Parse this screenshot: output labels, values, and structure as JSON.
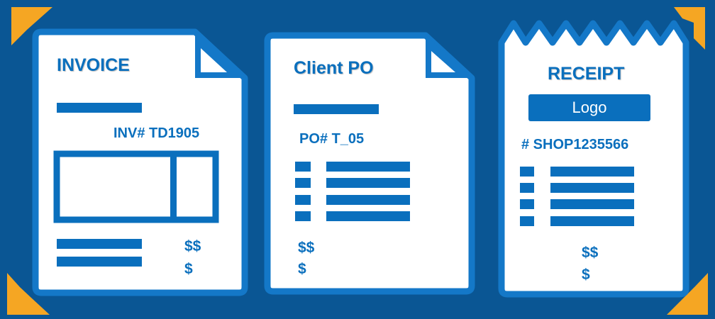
{
  "colors": {
    "background": "#0a5694",
    "accent_corner": "#f5a623",
    "document_fill": "#ffffff",
    "document_border": "#1478c8",
    "document_ink": "#0a6fbd"
  },
  "documents": {
    "invoice": {
      "title": "INVOICE",
      "number": "INV# TD1905",
      "amount_line_1": "$$",
      "amount_line_2": "$"
    },
    "client_po": {
      "title": "Client PO",
      "number": "PO# T_05",
      "amount_line_1": "$$",
      "amount_line_2": "$"
    },
    "receipt": {
      "title": "RECEIPT",
      "logo_label": "Logo",
      "number": "# SHOP1235566",
      "amount_line_1": "$$",
      "amount_line_2": "$"
    }
  }
}
